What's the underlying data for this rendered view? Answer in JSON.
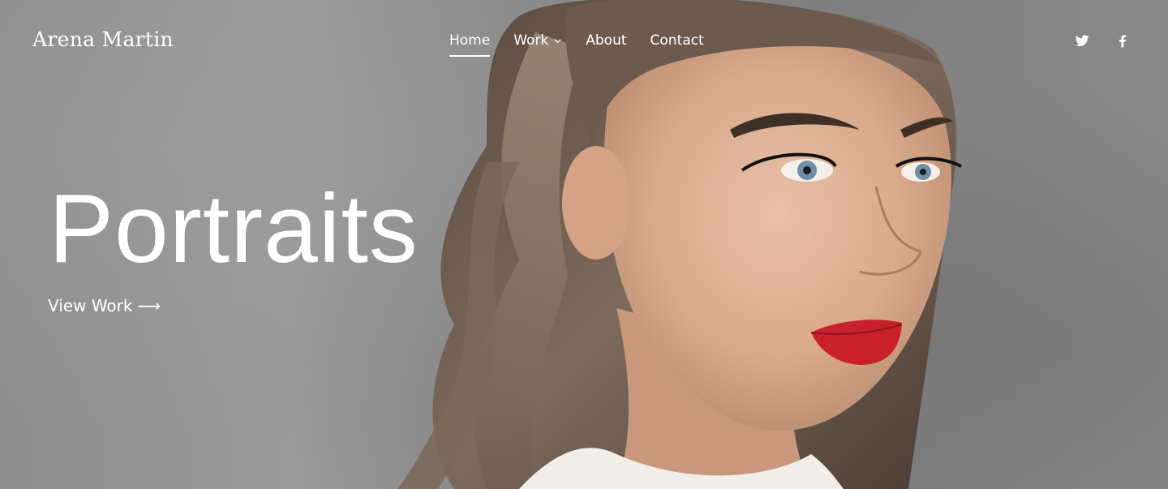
{
  "header": {
    "logo": "Arena Martin",
    "nav": [
      {
        "label": "Home",
        "active": true
      },
      {
        "label": "Work",
        "has_dropdown": true
      },
      {
        "label": "About"
      },
      {
        "label": "Contact"
      }
    ],
    "social": [
      "twitter-icon",
      "facebook-icon"
    ]
  },
  "hero": {
    "title": "Portraits",
    "cta_label": "View Work",
    "cta_arrow": "⟶"
  },
  "colors": {
    "text": "#ffffff",
    "lip_accent": "#c8202c"
  }
}
